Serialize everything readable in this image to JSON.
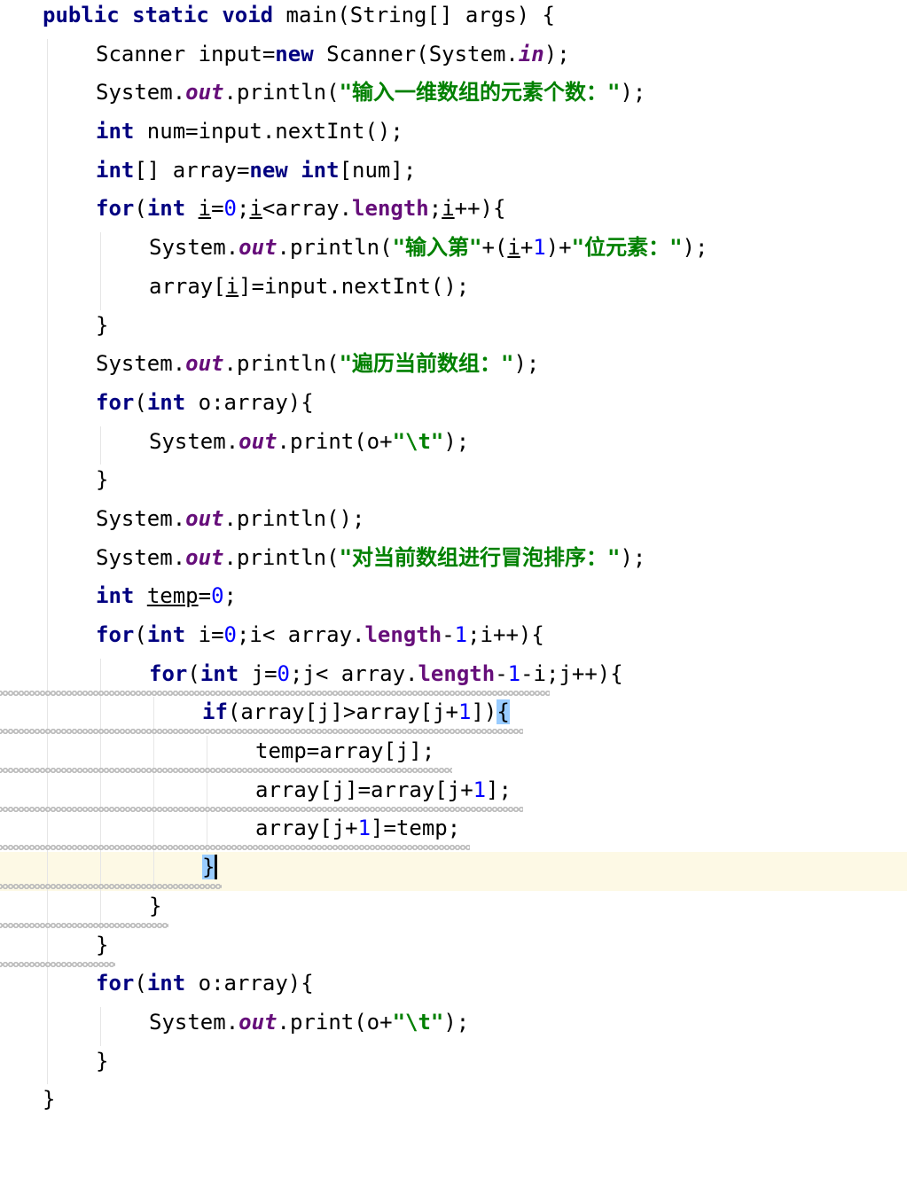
{
  "editor": {
    "lines": [
      {
        "indent": 0,
        "tokens": [
          {
            "t": "public",
            "c": "kw"
          },
          {
            "t": " "
          },
          {
            "t": "static",
            "c": "kw"
          },
          {
            "t": " "
          },
          {
            "t": "void",
            "c": "kw"
          },
          {
            "t": " main(String[] args) {"
          }
        ]
      },
      {
        "indent": 1,
        "tokens": [
          {
            "t": "Scanner input="
          },
          {
            "t": "new",
            "c": "kw"
          },
          {
            "t": " Scanner(System."
          },
          {
            "t": "in",
            "c": "static"
          },
          {
            "t": ");"
          }
        ]
      },
      {
        "indent": 1,
        "tokens": [
          {
            "t": "System."
          },
          {
            "t": "out",
            "c": "static"
          },
          {
            "t": ".println("
          },
          {
            "t": "\"输入一维数组的元素个数：\"",
            "c": "str"
          },
          {
            "t": ");"
          }
        ]
      },
      {
        "indent": 1,
        "tokens": [
          {
            "t": "int",
            "c": "kw"
          },
          {
            "t": " num=input.nextInt();"
          }
        ]
      },
      {
        "indent": 1,
        "tokens": [
          {
            "t": "int",
            "c": "kw"
          },
          {
            "t": "[] array="
          },
          {
            "t": "new",
            "c": "kw"
          },
          {
            "t": " "
          },
          {
            "t": "int",
            "c": "kw"
          },
          {
            "t": "[num];"
          }
        ]
      },
      {
        "indent": 1,
        "tokens": [
          {
            "t": "for",
            "c": "kw"
          },
          {
            "t": "("
          },
          {
            "t": "int",
            "c": "kw"
          },
          {
            "t": " "
          },
          {
            "t": "i",
            "c": "u"
          },
          {
            "t": "="
          },
          {
            "t": "0",
            "c": "num"
          },
          {
            "t": ";"
          },
          {
            "t": "i",
            "c": "u"
          },
          {
            "t": "<array."
          },
          {
            "t": "length",
            "c": "field"
          },
          {
            "t": ";"
          },
          {
            "t": "i",
            "c": "u"
          },
          {
            "t": "++){"
          }
        ]
      },
      {
        "indent": 2,
        "tokens": [
          {
            "t": "System."
          },
          {
            "t": "out",
            "c": "static"
          },
          {
            "t": ".println("
          },
          {
            "t": "\"输入第\"",
            "c": "str"
          },
          {
            "t": "+("
          },
          {
            "t": "i",
            "c": "u"
          },
          {
            "t": "+"
          },
          {
            "t": "1",
            "c": "num"
          },
          {
            "t": ")+"
          },
          {
            "t": "\"位元素：\"",
            "c": "str"
          },
          {
            "t": ");"
          }
        ]
      },
      {
        "indent": 2,
        "tokens": [
          {
            "t": "array["
          },
          {
            "t": "i",
            "c": "u"
          },
          {
            "t": "]=input.nextInt();"
          }
        ]
      },
      {
        "indent": 1,
        "tokens": [
          {
            "t": "}"
          }
        ]
      },
      {
        "indent": 1,
        "tokens": [
          {
            "t": "System."
          },
          {
            "t": "out",
            "c": "static"
          },
          {
            "t": ".println("
          },
          {
            "t": "\"遍历当前数组：\"",
            "c": "str"
          },
          {
            "t": ");"
          }
        ]
      },
      {
        "indent": 1,
        "tokens": [
          {
            "t": "for",
            "c": "kw"
          },
          {
            "t": "("
          },
          {
            "t": "int",
            "c": "kw"
          },
          {
            "t": " o:array){"
          }
        ]
      },
      {
        "indent": 2,
        "tokens": [
          {
            "t": "System."
          },
          {
            "t": "out",
            "c": "static"
          },
          {
            "t": ".print(o+"
          },
          {
            "t": "\"\\t\"",
            "c": "str"
          },
          {
            "t": ");"
          }
        ]
      },
      {
        "indent": 1,
        "tokens": [
          {
            "t": "}"
          }
        ]
      },
      {
        "indent": 1,
        "tokens": [
          {
            "t": "System."
          },
          {
            "t": "out",
            "c": "static"
          },
          {
            "t": ".println();"
          }
        ]
      },
      {
        "indent": 1,
        "tokens": [
          {
            "t": "System."
          },
          {
            "t": "out",
            "c": "static"
          },
          {
            "t": ".println("
          },
          {
            "t": "\"对当前数组进行冒泡排序：\"",
            "c": "str"
          },
          {
            "t": ");"
          }
        ]
      },
      {
        "indent": 1,
        "tokens": [
          {
            "t": "int",
            "c": "kw"
          },
          {
            "t": " "
          },
          {
            "t": "temp",
            "c": "u"
          },
          {
            "t": "="
          },
          {
            "t": "0",
            "c": "num"
          },
          {
            "t": ";"
          }
        ]
      },
      {
        "indent": 1,
        "tokens": [
          {
            "t": "for",
            "c": "kw"
          },
          {
            "t": "("
          },
          {
            "t": "int",
            "c": "kw"
          },
          {
            "t": " i="
          },
          {
            "t": "0",
            "c": "num"
          },
          {
            "t": ";i< array."
          },
          {
            "t": "length",
            "c": "field"
          },
          {
            "t": "-"
          },
          {
            "t": "1",
            "c": "num"
          },
          {
            "t": ";i++){"
          }
        ]
      },
      {
        "indent": 2,
        "tokens": [
          {
            "t": "for",
            "c": "kw"
          },
          {
            "t": "("
          },
          {
            "t": "int",
            "c": "kw"
          },
          {
            "t": " j="
          },
          {
            "t": "0",
            "c": "num"
          },
          {
            "t": ";j< array."
          },
          {
            "t": "length",
            "c": "field"
          },
          {
            "t": "-"
          },
          {
            "t": "1",
            "c": "num"
          },
          {
            "t": "-i;j++){"
          }
        ]
      },
      {
        "indent": 3,
        "tokens": [
          {
            "t": "if",
            "c": "kw"
          },
          {
            "t": "(array[j]>array[j+"
          },
          {
            "t": "1",
            "c": "num"
          },
          {
            "t": "])"
          },
          {
            "t": "{",
            "c": "bh"
          }
        ]
      },
      {
        "indent": 4,
        "tokens": [
          {
            "t": "temp=array[j];"
          }
        ]
      },
      {
        "indent": 4,
        "tokens": [
          {
            "t": "array[j]=array[j+"
          },
          {
            "t": "1",
            "c": "num"
          },
          {
            "t": "];"
          }
        ]
      },
      {
        "indent": 4,
        "tokens": [
          {
            "t": "array[j+"
          },
          {
            "t": "1",
            "c": "num"
          },
          {
            "t": "]=temp;"
          }
        ]
      },
      {
        "indent": 3,
        "current": true,
        "tokens": [
          {
            "t": "}",
            "c": "caret"
          }
        ]
      },
      {
        "indent": 2,
        "tokens": [
          {
            "t": "}"
          }
        ]
      },
      {
        "indent": 1,
        "tokens": [
          {
            "t": "}"
          }
        ]
      },
      {
        "indent": 1,
        "tokens": [
          {
            "t": "for",
            "c": "kw"
          },
          {
            "t": "("
          },
          {
            "t": "int",
            "c": "kw"
          },
          {
            "t": " o:array){"
          }
        ]
      },
      {
        "indent": 2,
        "tokens": [
          {
            "t": "System."
          },
          {
            "t": "out",
            "c": "static"
          },
          {
            "t": ".print(o+"
          },
          {
            "t": "\"\\t\"",
            "c": "str"
          },
          {
            "t": ");"
          }
        ]
      },
      {
        "indent": 1,
        "tokens": [
          {
            "t": "}"
          }
        ]
      },
      {
        "indent": 0,
        "tokens": [
          {
            "t": "}"
          }
        ]
      }
    ]
  }
}
